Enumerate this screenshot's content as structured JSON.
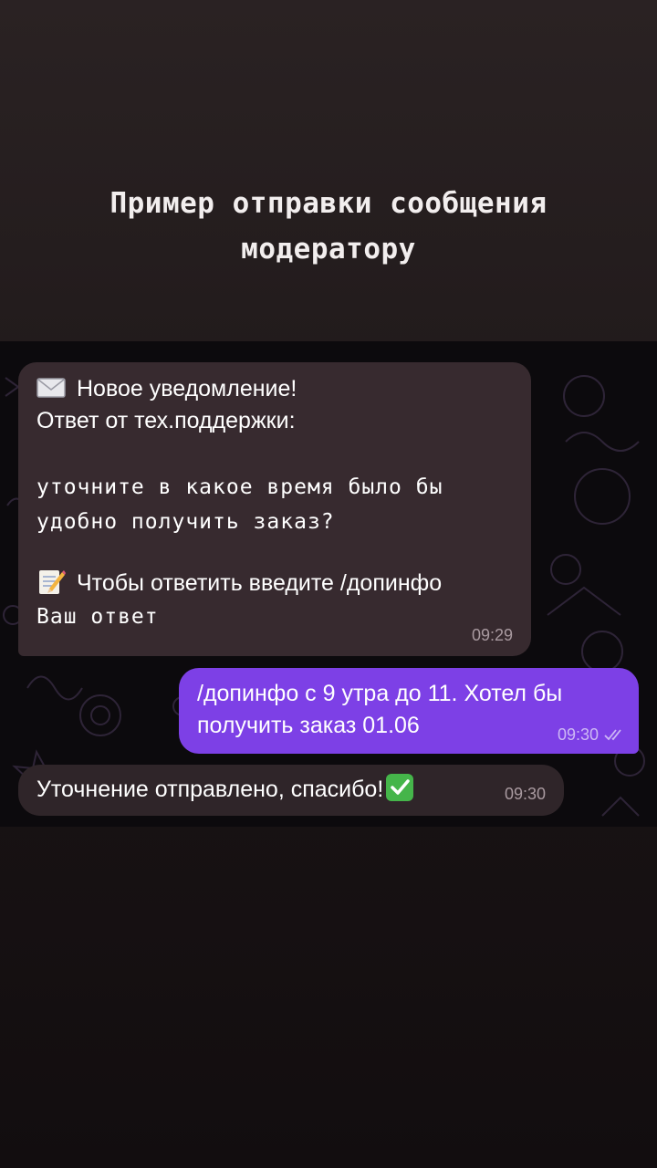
{
  "story": {
    "title_line1": "Пример отправки сообщения",
    "title_line2": "модератору"
  },
  "chat": {
    "incoming": {
      "header_icon": "envelope-emoji",
      "line1": "Новое уведомление!",
      "line2": "Ответ от тех.поддержки:",
      "question_line1": "уточните в какое время было бы",
      "question_line2": "удобно получить заказ?",
      "instruction_icon": "memo-emoji",
      "instruction": "Чтобы ответить введите /допинфо",
      "answer_label": "Ваш ответ",
      "time": "09:29"
    },
    "outgoing": {
      "line1": "/допинфо с 9 утра до 11. Хотел бы",
      "line2": "получить заказ 01.06",
      "time": "09:30",
      "status_icon": "double-check-icon"
    },
    "confirmation": {
      "text": "Уточнение отправлено, спасибо!",
      "icon": "check-mark-button-emoji",
      "time": "09:30"
    }
  },
  "colors": {
    "outgoing_bubble": "#7d40e6",
    "incoming_bubble": "#372a2f",
    "chat_background": "#0c0a0d"
  }
}
